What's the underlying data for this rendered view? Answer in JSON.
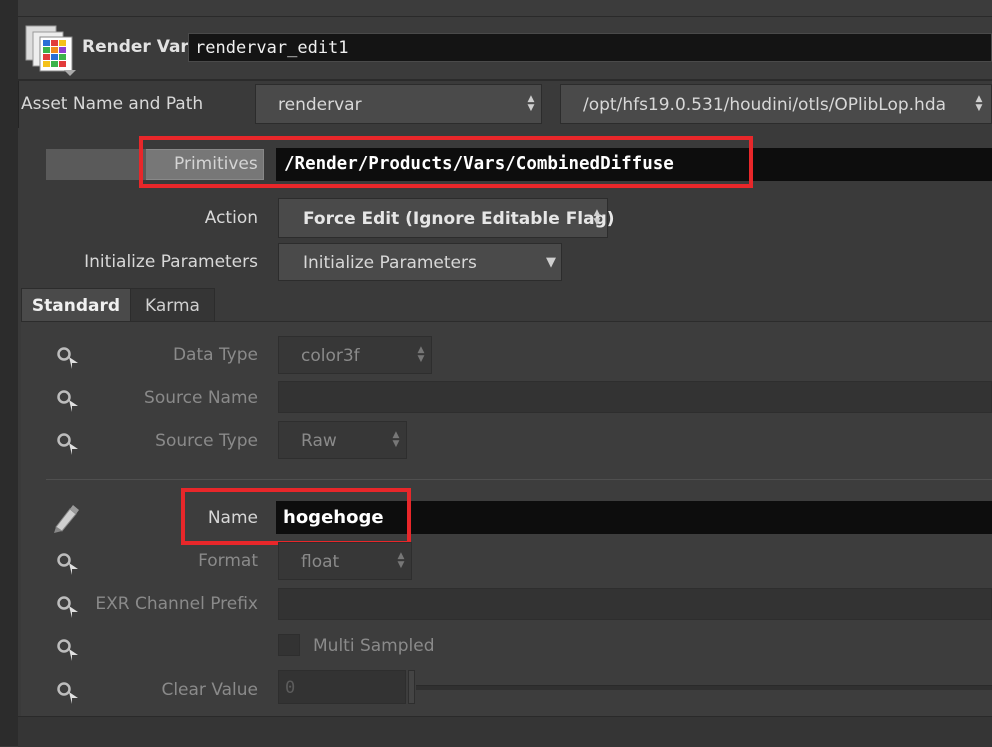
{
  "node": {
    "type_label": "Render Var",
    "name": "rendervar_edit1"
  },
  "asset": {
    "label": "Asset Name and Path",
    "name": "rendervar",
    "path": "/opt/hfs19.0.531/houdini/otls/OPlibLop.hda"
  },
  "primitives": {
    "label": "Primitives",
    "value": "/Render/Products/Vars/CombinedDiffuse"
  },
  "action": {
    "label": "Action",
    "value": "Force Edit (Ignore Editable Flag)"
  },
  "init_params": {
    "label": "Initialize Parameters",
    "button": "Initialize Parameters"
  },
  "tabs": [
    {
      "label": "Standard",
      "active": true
    },
    {
      "label": "Karma",
      "active": false
    }
  ],
  "params": {
    "data_type": {
      "label": "Data Type",
      "value": "color3f"
    },
    "source_name": {
      "label": "Source Name",
      "value": ""
    },
    "source_type": {
      "label": "Source Type",
      "value": "Raw"
    },
    "name": {
      "label": "Name",
      "value": "hogehoge"
    },
    "format": {
      "label": "Format",
      "value": "float"
    },
    "exr_prefix": {
      "label": "EXR Channel Prefix",
      "value": ""
    },
    "multi_sampled": {
      "label": "Multi Sampled",
      "checked": false
    },
    "clear_value": {
      "label": "Clear Value",
      "value": "0"
    }
  },
  "colors": {
    "highlight_border": "#e8272a",
    "panel_bg": "#3a3a3a",
    "field_bg": "#0d0d0d"
  }
}
